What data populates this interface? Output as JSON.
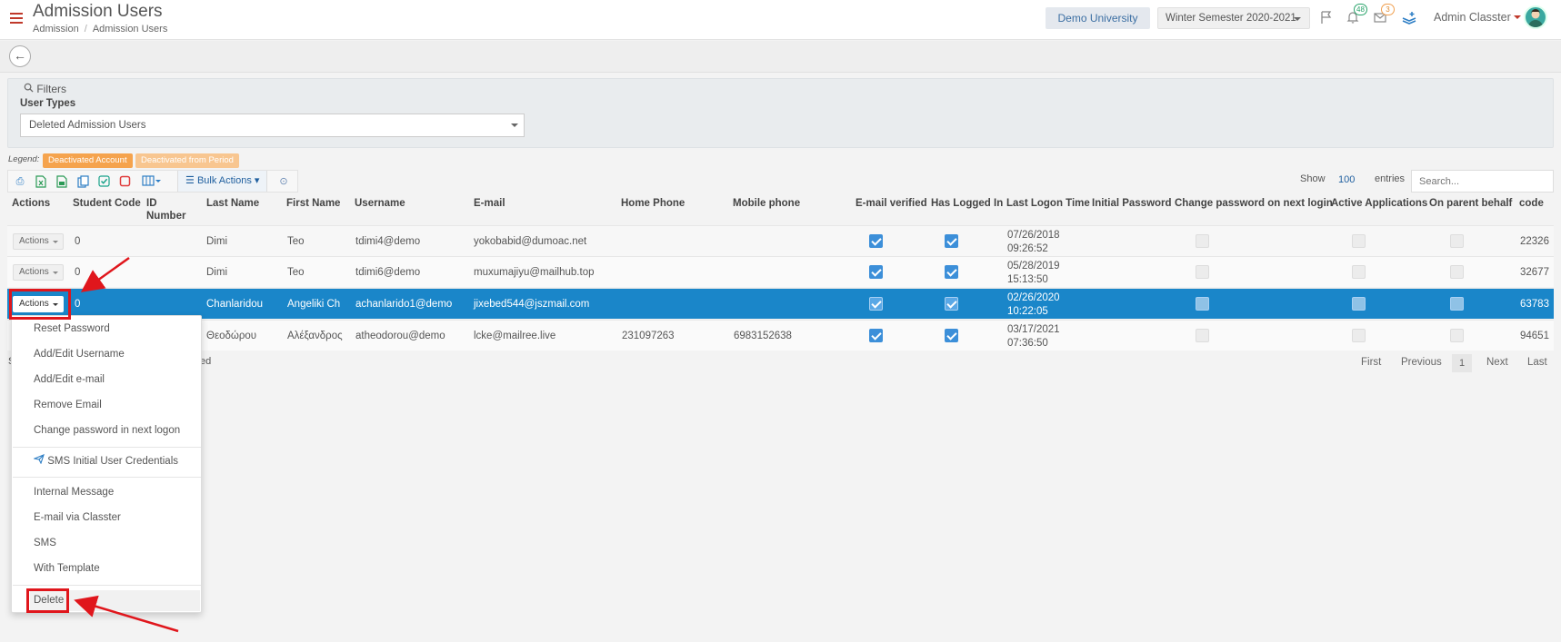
{
  "header": {
    "title": "Admission Users",
    "breadcrumb": [
      "Admission",
      "Admission Users"
    ],
    "university": "Demo University",
    "semester": "Winter Semester 2020-2021",
    "notifications_count": "48",
    "messages_count": "3",
    "user_name": "Admin Classter"
  },
  "filters": {
    "title": "Filters",
    "user_types_label": "User Types",
    "user_types_value": "Deleted Admission Users"
  },
  "legend": {
    "label": "Legend:",
    "items": [
      {
        "text": "Deactivated Account",
        "color": "#f5a34d"
      },
      {
        "text": "Deactivated from Period",
        "color": "#f8c690"
      }
    ]
  },
  "toolbar": {
    "bulk_actions": "Bulk Actions",
    "show_label": "Show",
    "show_value": "100",
    "entries_label": "entries",
    "search_placeholder": "Search..."
  },
  "table": {
    "columns": [
      "Actions",
      "Student Code",
      "ID Number",
      "Last Name",
      "First Name",
      "Username",
      "E-mail",
      "Home Phone",
      "Mobile phone",
      "E-mail verified",
      "Has Logged In",
      "Last Logon Time",
      "Initial Password",
      "Change password on next login",
      "Active Applications",
      "On parent behalf",
      "code"
    ],
    "action_label": "Actions",
    "rows": [
      {
        "student_code": "0",
        "last_name": "Dimi",
        "first_name": "Teo",
        "username": "tdimi4@demo",
        "email": "yokobabid@dumoac.net",
        "home_phone": "",
        "mobile": "",
        "logon_date": "07/26/2018",
        "logon_time": "09:26:52",
        "code": "22326"
      },
      {
        "student_code": "0",
        "last_name": "Dimi",
        "first_name": "Teo",
        "username": "tdimi6@demo",
        "email": "muxumajiyu@mailhub.top",
        "home_phone": "",
        "mobile": "",
        "logon_date": "05/28/2019",
        "logon_time": "15:13:50",
        "code": "32677"
      },
      {
        "student_code": "0",
        "last_name": "Chanlaridou",
        "first_name": "Angeliki Ch",
        "username": "achanlarido1@demo",
        "email": "jixebed544@jszmail.com",
        "home_phone": "",
        "mobile": "",
        "logon_date": "02/26/2020",
        "logon_time": "10:22:05",
        "code": "63783"
      },
      {
        "student_code": "",
        "last_name": "Θεοδώρου",
        "first_name": "Αλέξανδρος",
        "username": "atheodorou@demo",
        "email": "lcke@mailree.live",
        "home_phone": "231097263",
        "mobile": "6983152638",
        "logon_date": "03/17/2021",
        "logon_time": "07:36:50",
        "code": "94651"
      }
    ]
  },
  "status_fragment_left": "S",
  "status_fragment_right": "ed",
  "pagination": {
    "first": "First",
    "previous": "Previous",
    "page": "1",
    "next": "Next",
    "last": "Last"
  },
  "actions_menu": {
    "items": [
      "Reset Password",
      "Add/Edit Username",
      "Add/Edit e-mail",
      "Remove Email",
      "Change password in next logon",
      "SMS Initial User Credentials",
      "Internal Message",
      "E-mail via Classter",
      "SMS",
      "With Template",
      "Delete"
    ]
  },
  "colors": {
    "accent": "#1a86c9",
    "annotation": "#e0161c",
    "hamburger": "#c0392b"
  }
}
